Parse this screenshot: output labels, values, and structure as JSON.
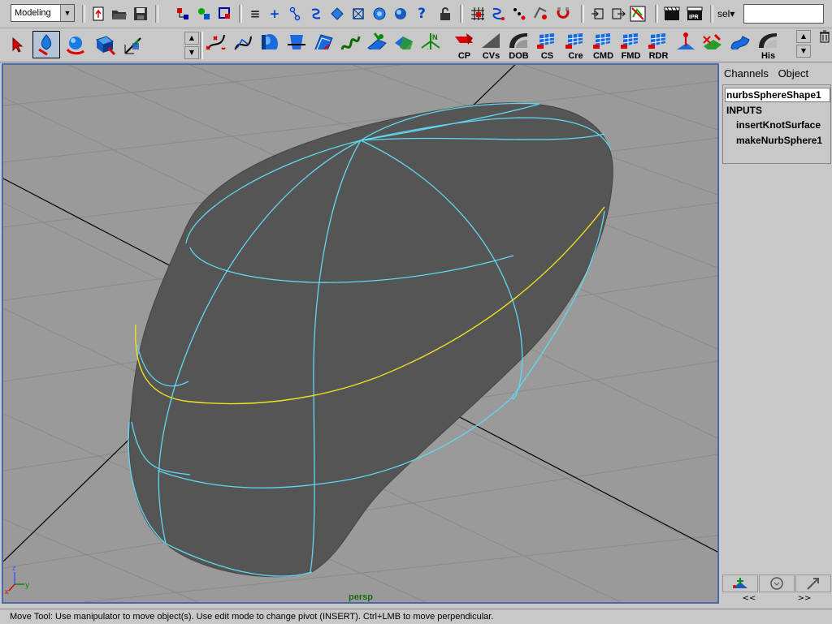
{
  "toolbar": {
    "mode": "Modeling",
    "sel_label": "sel▾",
    "sel_value": ""
  },
  "shelf": {
    "labels": {
      "cp": "CP",
      "cvs": "CVs",
      "dob": "DOB",
      "cs": "CS",
      "cre": "Cre",
      "cmd": "CMD",
      "fmd": "FMD",
      "rdr": "RDR",
      "his": "His"
    }
  },
  "viewport": {
    "camera": "persp",
    "axis": {
      "x": "x",
      "y": "y",
      "z": "z"
    },
    "colors": {
      "background": "#9a9a9a",
      "grid": "#8a8a8a",
      "surface": "#555555",
      "isoparm": "#5fd8f0",
      "selected_isoparm": "#f0e020",
      "border": "#4a6aa8"
    }
  },
  "channel_box": {
    "tabs": {
      "channels": "Channels",
      "object": "Object"
    },
    "object_name": "nurbsSphereShape1",
    "inputs_header": "INPUTS",
    "inputs": [
      "insertKnotSurface",
      "makeNurbSphere1"
    ],
    "nav_prev": "<<",
    "nav_next": ">>"
  },
  "status": {
    "message": "Move Tool: Use manipulator to move object(s). Use edit mode to change pivot (INSERT).  Ctrl+LMB to move perpendicular."
  }
}
